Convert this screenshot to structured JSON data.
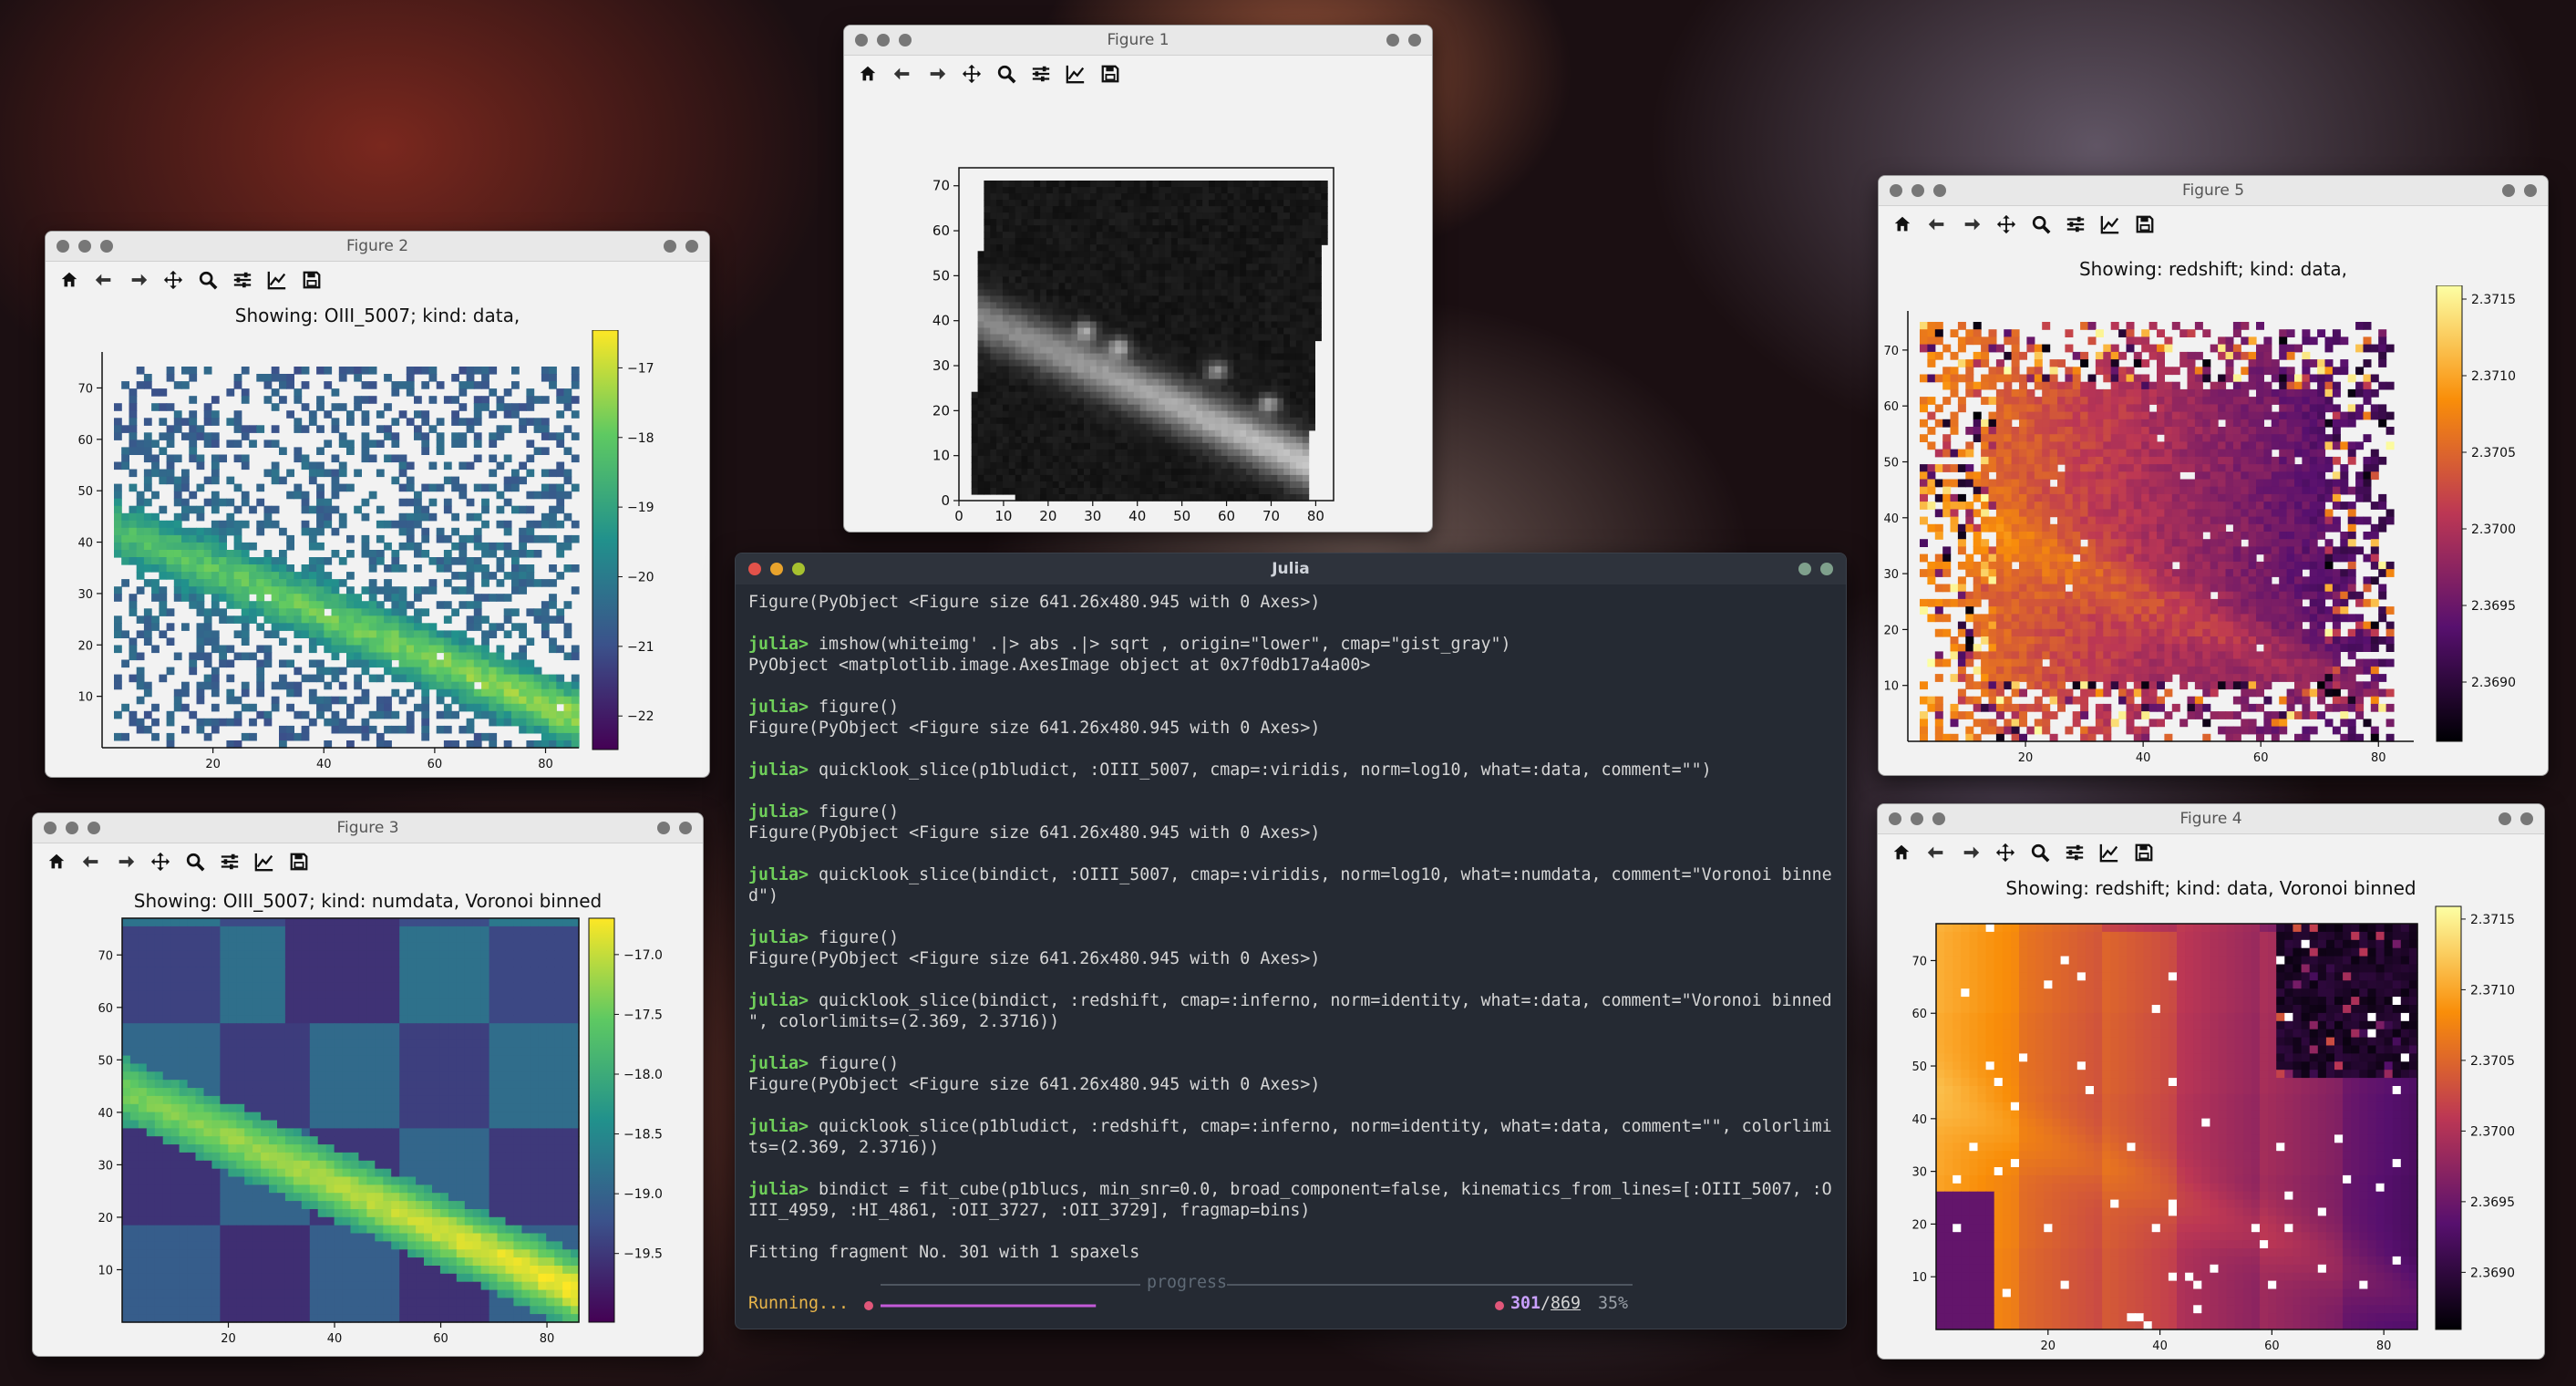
{
  "fig1": {
    "title": "Figure 1",
    "yticks": [
      "70",
      "60",
      "50",
      "40",
      "30",
      "20",
      "10",
      "0"
    ],
    "xticks": [
      "0",
      "10",
      "20",
      "30",
      "40",
      "50",
      "60",
      "70",
      "80"
    ]
  },
  "fig2": {
    "title": "Figure 2",
    "plot_title": "Showing: OIII_5007; kind: data,",
    "yticks": [
      "70",
      "60",
      "50",
      "40",
      "30",
      "20",
      "10"
    ],
    "xticks": [
      "20",
      "40",
      "60",
      "80"
    ],
    "cticks": [
      "−17",
      "−18",
      "−19",
      "−20",
      "−21",
      "−22"
    ]
  },
  "fig3": {
    "title": "Figure 3",
    "plot_title": "Showing: OIII_5007; kind: numdata, Voronoi binned",
    "yticks": [
      "70",
      "60",
      "50",
      "40",
      "30",
      "20",
      "10"
    ],
    "xticks": [
      "20",
      "40",
      "60",
      "80"
    ],
    "cticks": [
      "−17.0",
      "−17.5",
      "−18.0",
      "−18.5",
      "−19.0",
      "−19.5"
    ]
  },
  "fig5": {
    "title": "Figure 5",
    "plot_title": "Showing: redshift; kind: data,",
    "yticks": [
      "70",
      "60",
      "50",
      "40",
      "30",
      "20",
      "10"
    ],
    "xticks": [
      "20",
      "40",
      "60",
      "80"
    ],
    "cticks": [
      "2.3715",
      "2.3710",
      "2.3705",
      "2.3700",
      "2.3695",
      "2.3690"
    ]
  },
  "fig4": {
    "title": "Figure 4",
    "plot_title": "Showing: redshift; kind: data, Voronoi binned",
    "yticks": [
      "70",
      "60",
      "50",
      "40",
      "30",
      "20",
      "10"
    ],
    "xticks": [
      "20",
      "40",
      "60",
      "80"
    ],
    "cticks": [
      "2.3715",
      "2.3710",
      "2.3705",
      "2.3700",
      "2.3695",
      "2.3690"
    ]
  },
  "toolbar_icons": [
    "home-icon",
    "back-arrow-icon",
    "forward-arrow-icon",
    "pan-icon",
    "zoom-icon",
    "subplots-config-icon",
    "edit-axes-icon",
    "save-icon"
  ],
  "terminal": {
    "title": "Julia",
    "lines": [
      {
        "p": "",
        "t": "Figure(PyObject <Figure size 641.26x480.945 with 0 Axes>)"
      },
      {
        "p": "",
        "t": ""
      },
      {
        "p": "julia>",
        "t": " imshow(whiteimg' .|> abs .|> sqrt , origin=\"lower\", cmap=\"gist_gray\")"
      },
      {
        "p": "",
        "t": "PyObject <matplotlib.image.AxesImage object at 0x7f0db17a4a00>"
      },
      {
        "p": "",
        "t": ""
      },
      {
        "p": "julia>",
        "t": " figure()"
      },
      {
        "p": "",
        "t": "Figure(PyObject <Figure size 641.26x480.945 with 0 Axes>)"
      },
      {
        "p": "",
        "t": ""
      },
      {
        "p": "julia>",
        "t": " quicklook_slice(p1bludict, :OIII_5007, cmap=:viridis, norm=log10, what=:data, comment=\"\")"
      },
      {
        "p": "",
        "t": ""
      },
      {
        "p": "julia>",
        "t": " figure()"
      },
      {
        "p": "",
        "t": "Figure(PyObject <Figure size 641.26x480.945 with 0 Axes>)"
      },
      {
        "p": "",
        "t": ""
      },
      {
        "p": "julia>",
        "t": " quicklook_slice(bindict, :OIII_5007, cmap=:viridis, norm=log10, what=:numdata, comment=\"Voronoi binne"
      },
      {
        "p": "",
        "t": "d\")"
      },
      {
        "p": "",
        "t": ""
      },
      {
        "p": "julia>",
        "t": " figure()"
      },
      {
        "p": "",
        "t": "Figure(PyObject <Figure size 641.26x480.945 with 0 Axes>)"
      },
      {
        "p": "",
        "t": ""
      },
      {
        "p": "julia>",
        "t": " quicklook_slice(bindict, :redshift, cmap=:inferno, norm=identity, what=:data, comment=\"Voronoi binned"
      },
      {
        "p": "",
        "t": "\", colorlimits=(2.369, 2.3716))"
      },
      {
        "p": "",
        "t": ""
      },
      {
        "p": "julia>",
        "t": " figure()"
      },
      {
        "p": "",
        "t": "Figure(PyObject <Figure size 641.26x480.945 with 0 Axes>)"
      },
      {
        "p": "",
        "t": ""
      },
      {
        "p": "julia>",
        "t": " quicklook_slice(p1bludict, :redshift, cmap=:inferno, norm=identity, what=:data, comment=\"\", colorlimi"
      },
      {
        "p": "",
        "t": "ts=(2.369, 2.3716))"
      },
      {
        "p": "",
        "t": ""
      },
      {
        "p": "julia>",
        "t": " bindict = fit_cube(p1blucs, min_snr=0.0, broad_component=false, kinematics_from_lines=[:OIII_5007, :O"
      },
      {
        "p": "",
        "t": "III_4959, :HI_4861, :OII_3727, :OII_3729], fragmap=bins)"
      },
      {
        "p": "",
        "t": ""
      },
      {
        "p": "",
        "t": "Fitting fragment No. 301 with 1 spaxels"
      }
    ],
    "progress_label": "progress",
    "running": "Running...",
    "count_done": "301",
    "count_total": "869",
    "percent": "35%",
    "fraction": 0.35
  }
}
